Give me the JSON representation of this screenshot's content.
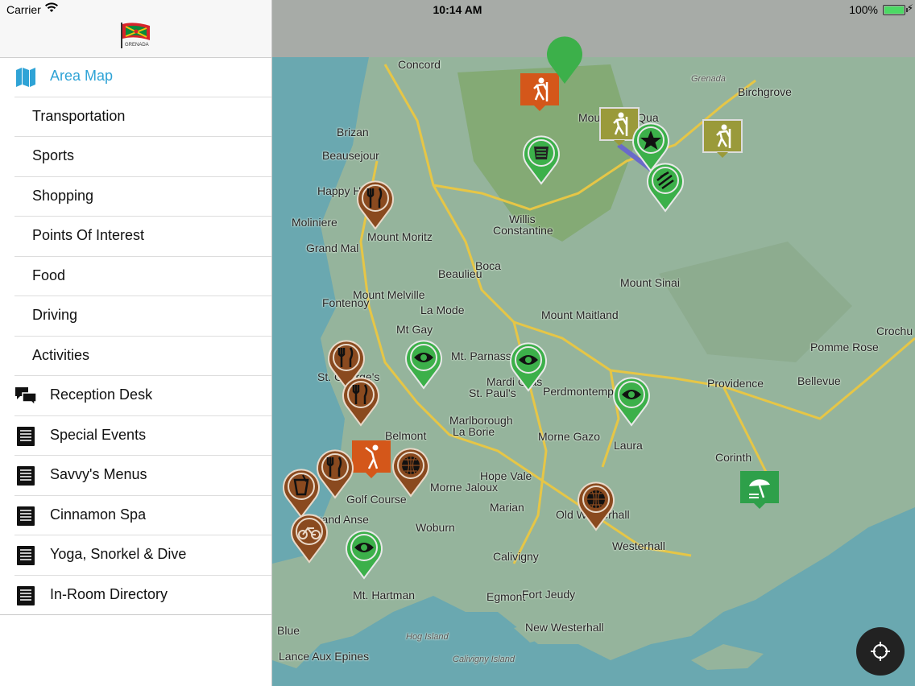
{
  "status_bar": {
    "carrier": "Carrier",
    "time": "10:14 AM",
    "battery": "100%"
  },
  "header": {
    "logo_text": "GRENADA"
  },
  "menu": {
    "items": [
      {
        "label": "Area Map",
        "icon": "map-icon",
        "active": true
      },
      {
        "label": "Transportation"
      },
      {
        "label": "Sports"
      },
      {
        "label": "Shopping"
      },
      {
        "label": "Points Of Interest"
      },
      {
        "label": "Food"
      },
      {
        "label": "Driving"
      },
      {
        "label": "Activities"
      },
      {
        "label": "Reception Desk",
        "icon": "chat-icon"
      },
      {
        "label": "Special Events",
        "icon": "document-icon"
      },
      {
        "label": "Savvy's Menus",
        "icon": "document-icon"
      },
      {
        "label": "Cinnamon Spa",
        "icon": "document-icon"
      },
      {
        "label": "Yoga, Snorkel & Dive",
        "icon": "document-icon"
      },
      {
        "label": "In-Room Directory",
        "icon": "document-icon"
      }
    ]
  },
  "map": {
    "places": [
      "Concord",
      "Grenada",
      "Birchgrove",
      "Mount Qua Qua",
      "Brizan",
      "Beausejour",
      "Happy Hill",
      "Moliniere",
      "Mount Moritz",
      "Willis",
      "Constantine",
      "Grand Mal",
      "Boca",
      "Beaulieu",
      "Mount Sinai",
      "Fontenoy",
      "Mount Melville",
      "La Mode",
      "Mount Maitland",
      "Mt Gay",
      "Crochu",
      "Mt. Parnassus",
      "Pomme Rose",
      "St. George's",
      "Mardi Gras",
      "St. Paul's",
      "Perdmontemps",
      "Providence",
      "Bellevue",
      "Marlborough",
      "La Borie",
      "Belmont",
      "Morne Gazo",
      "Laura",
      "Corinth",
      "Hope Vale",
      "Morne Jaloux",
      "Golf Course",
      "Marian",
      "Old Westerhall",
      "Woburn",
      "Westerhall",
      "Grand Anse",
      "Calivigny",
      "Mt. Hartman",
      "Egmont",
      "Fort Jeudy",
      "New Westerhall",
      "Hog Island",
      "Blue",
      "Calivigny Island",
      "Lance Aux Epines"
    ],
    "colors": {
      "green": "#3cb04a",
      "brown": "#8a4a1f",
      "orange": "#d4571a",
      "olive": "#9a9a3a",
      "water": "#6aa8b0",
      "land": "#95b49c"
    }
  }
}
